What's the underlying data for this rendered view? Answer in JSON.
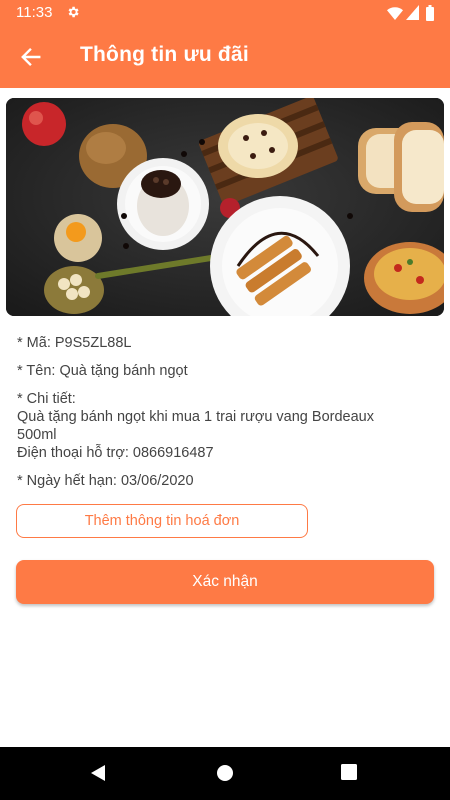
{
  "status_bar": {
    "time": "11:33",
    "icons": [
      "gear-icon",
      "wifi-icon",
      "cell-signal-icon",
      "battery-icon"
    ]
  },
  "app_bar": {
    "back_icon": "arrow-left-icon",
    "title": "Thông tin ưu đãi"
  },
  "hero_image": {
    "description_icon": "food-photo"
  },
  "voucher": {
    "code_line": "* Mã: P9S5ZL88L",
    "name_line": "* Tên: Quà tặng bánh ngọt",
    "detail_label": "* Chi tiết:",
    "detail_lines": [
      "Quà tặng bánh ngọt  khi mua 1 trai rượu vang Bordeaux",
      "500ml",
      "Điện thoại hỗ trợ: 0866916487"
    ],
    "expiry_line": "* Ngày hết hạn: 03/06/2020"
  },
  "actions": {
    "add_invoice_label": "Thêm thông tin hoá đơn",
    "confirm_label": "Xác nhận"
  },
  "nav_bar": {
    "icons": [
      "back-triangle-icon",
      "home-circle-icon",
      "recents-square-icon"
    ]
  },
  "colors": {
    "accent": "#fe7a45",
    "text": "#444444",
    "nav_background": "#000000"
  }
}
